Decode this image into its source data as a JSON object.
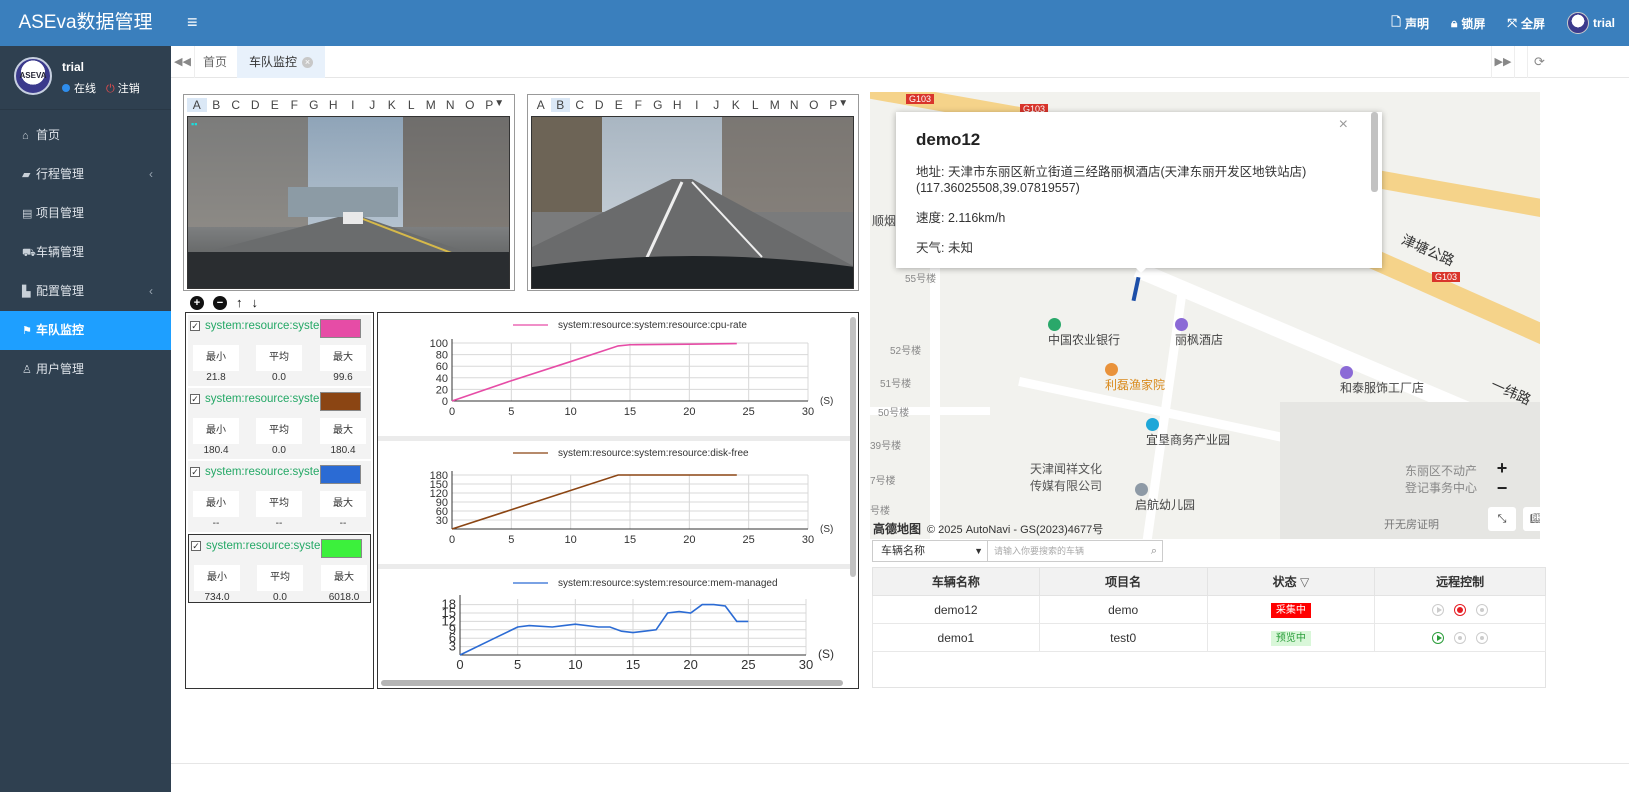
{
  "app": {
    "title": "ASEva数据管理"
  },
  "user": {
    "name": "trial",
    "status": "在线",
    "logout": "注销"
  },
  "nav": [
    {
      "label": "首页",
      "icon": "home-icon"
    },
    {
      "label": "行程管理",
      "icon": "book-icon",
      "has_children": true
    },
    {
      "label": "项目管理",
      "icon": "id-card-icon"
    },
    {
      "label": "车辆管理",
      "icon": "car-icon"
    },
    {
      "label": "配置管理",
      "icon": "config-icon",
      "has_children": true
    },
    {
      "label": "车队监控",
      "icon": "flag-icon",
      "active": true
    },
    {
      "label": "用户管理",
      "icon": "user-icon"
    }
  ],
  "topbar": {
    "statement": "声明",
    "lock": "锁屏",
    "fullscreen": "全屏",
    "user": "trial"
  },
  "tabs": [
    {
      "label": "首页"
    },
    {
      "label": "车队监控",
      "active": true
    }
  ],
  "video": {
    "channels": [
      "A",
      "B",
      "C",
      "D",
      "E",
      "F",
      "G",
      "H",
      "I",
      "J",
      "K",
      "L",
      "M",
      "N",
      "O",
      "P"
    ],
    "left": {
      "selected": "A"
    },
    "right": {
      "selected": "B"
    }
  },
  "series": [
    {
      "name": "system:resource:syste",
      "color": "#e64ca6",
      "min_label": "最小",
      "avg_label": "平均",
      "max_label": "最大",
      "min": "21.8",
      "avg": "0.0",
      "max": "99.6",
      "checked": true
    },
    {
      "name": "system:resource:syste",
      "color": "#8b4513",
      "min_label": "最小",
      "avg_label": "平均",
      "max_label": "最大",
      "min": "180.4",
      "avg": "0.0",
      "max": "180.4",
      "checked": true
    },
    {
      "name": "system:resource:syste",
      "color": "#2b6bd4",
      "min_label": "最小",
      "avg_label": "平均",
      "max_label": "最大",
      "min": "--",
      "avg": "--",
      "max": "--",
      "checked": true
    },
    {
      "name": "system:resource:syste",
      "color": "#3cf03c",
      "min_label": "最小",
      "avg_label": "平均",
      "max_label": "最大",
      "min": "734.0",
      "avg": "0.0",
      "max": "6018.0",
      "checked": true,
      "selected": true
    }
  ],
  "chart_data": [
    {
      "type": "line",
      "series": [
        {
          "name": "system:resource:system:resource:cpu-rate",
          "color": "#e64ca6",
          "x": [
            0,
            5,
            10,
            14,
            15,
            20,
            24
          ],
          "y": [
            0,
            35,
            68,
            95,
            97,
            98,
            99
          ]
        }
      ],
      "xlim": [
        0,
        30
      ],
      "ylim": [
        0,
        100
      ],
      "xticks": [
        0,
        5,
        10,
        15,
        20,
        25,
        30
      ],
      "yticks": [
        0,
        20,
        40,
        60,
        80,
        100
      ],
      "xunit": "(S)"
    },
    {
      "type": "line",
      "series": [
        {
          "name": "system:resource:system:resource:disk-free",
          "color": "#8b4513",
          "x": [
            0,
            14,
            24
          ],
          "y": [
            0,
            180,
            180
          ]
        }
      ],
      "xlim": [
        0,
        30
      ],
      "ylim": [
        0,
        180
      ],
      "xticks": [
        0,
        5,
        10,
        15,
        20,
        25,
        30
      ],
      "yticks": [
        30,
        60,
        90,
        120,
        150,
        180
      ],
      "xunit": "(S)"
    },
    {
      "type": "line",
      "series": [
        {
          "name": "system:resource:system:resource:mem-managed",
          "color": "#2b6bd4",
          "x": [
            0,
            3,
            5,
            6,
            8,
            9,
            10,
            12,
            13,
            14,
            15,
            16,
            17,
            18,
            19,
            20,
            21,
            22,
            23,
            24,
            25
          ],
          "y": [
            0,
            6,
            10,
            10.5,
            10,
            10.5,
            11,
            10,
            10,
            8.5,
            8,
            8.5,
            9,
            15,
            15.5,
            15,
            18,
            18,
            17.5,
            12,
            12
          ]
        }
      ],
      "xlim": [
        0,
        30
      ],
      "ylim": [
        0,
        20
      ],
      "xticks": [
        0,
        5,
        10,
        15,
        20,
        25,
        30
      ],
      "yticks": [
        3,
        6,
        9,
        12,
        15,
        18
      ],
      "xunit": "(S)"
    }
  ],
  "map": {
    "popup": {
      "title": "demo12",
      "address": "地址: 天津市东丽区新立街道三经路丽枫酒店(天津东丽开发区地铁站店)(117.36025508,39.07819557)",
      "speed": "速度: 2.116km/h",
      "weather": "天气: 未知"
    },
    "labels": [
      "中国农业银行",
      "丽枫酒店",
      "利磊渔家院",
      "和泰服饰工厂店",
      "宜垦商务产业园",
      "天津闻祥文化",
      "传媒有限公司",
      "启航幼儿园",
      "东丽区不动产",
      "登记事务中心",
      "开无房证明",
      "津塘公路",
      "一纬路",
      "顺烟",
      "55号楼",
      "52号楼",
      "51号楼",
      "50号楼",
      "39号楼",
      "7号楼",
      "号楼"
    ],
    "road_badges": [
      "G103",
      "G103",
      "G103"
    ],
    "logo": "高德地图",
    "attribution": "© 2025 AutoNavi - GS(2023)4677号",
    "zoom_in": "+",
    "zoom_out": "−"
  },
  "search": {
    "field": "车辆名称",
    "placeholder": "请输入你要搜索的车辆"
  },
  "table": {
    "headers": [
      "车辆名称",
      "项目名",
      "状态",
      "远程控制"
    ],
    "rows": [
      {
        "name": "demo12",
        "project": "demo",
        "status": "采集中",
        "status_color": "#ff0000",
        "status_text_color": "#ffffff"
      },
      {
        "name": "demo1",
        "project": "test0",
        "status": "预览中",
        "status_color": "#d9f7d9",
        "status_text_color": "#2a9d3a"
      }
    ]
  }
}
